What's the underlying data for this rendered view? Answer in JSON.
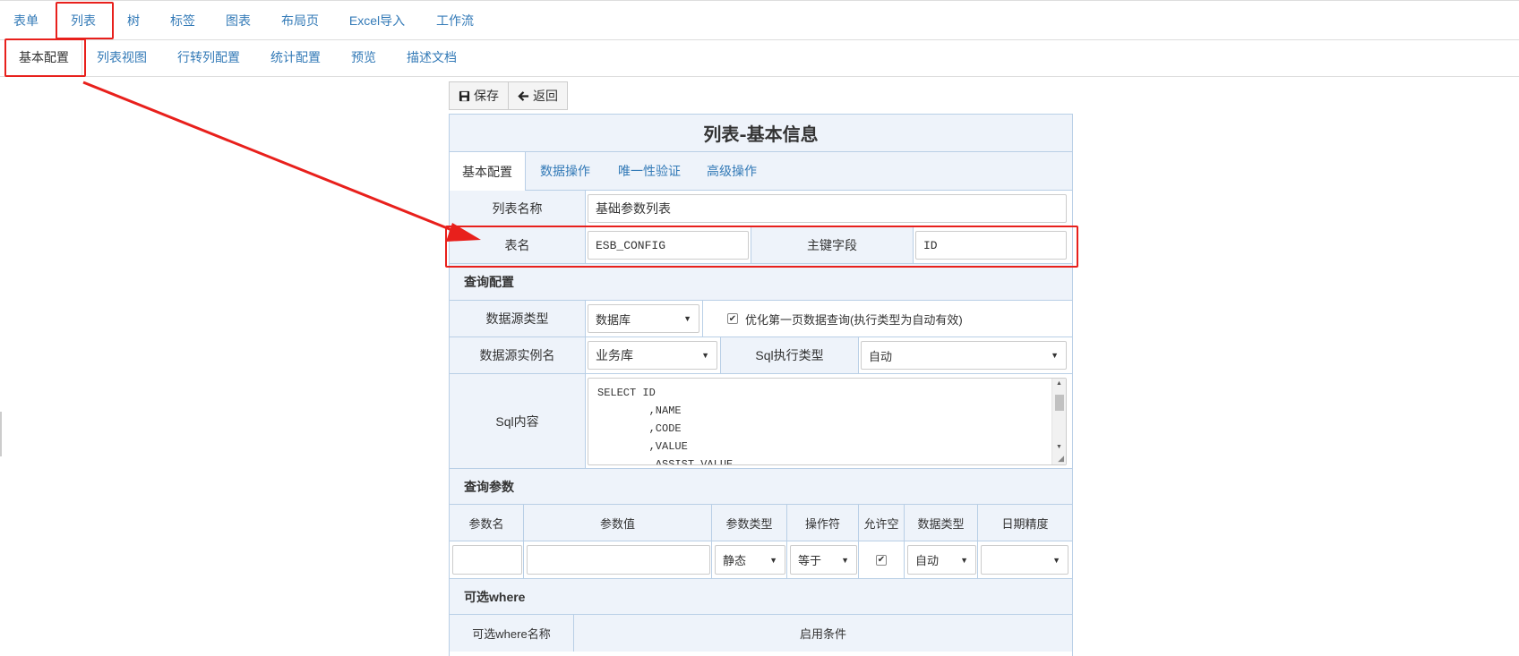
{
  "top_tabs": [
    "表单",
    "列表",
    "树",
    "标签",
    "图表",
    "布局页",
    "Excel导入",
    "工作流"
  ],
  "sub_tabs": [
    "基本配置",
    "列表视图",
    "行转列配置",
    "统计配置",
    "预览",
    "描述文档"
  ],
  "toolbar": {
    "save": "保存",
    "back": "返回"
  },
  "panel": {
    "title": "列表-基本信息",
    "tabs": [
      "基本配置",
      "数据操作",
      "唯一性验证",
      "高级操作"
    ]
  },
  "form": {
    "list_name_label": "列表名称",
    "list_name_value": "基础参数列表",
    "table_name_label": "表名",
    "table_name_value": "ESB_CONFIG",
    "pk_label": "主键字段",
    "pk_value": "ID",
    "query_config_title": "查询配置",
    "ds_type_label": "数据源类型",
    "ds_type_value": "数据库",
    "optimize_label": "优化第一页数据查询(执行类型为自动有效)",
    "ds_instance_label": "数据源实例名",
    "ds_instance_value": "业务库",
    "sql_exec_label": "Sql执行类型",
    "sql_exec_value": "自动",
    "sql_content_label": "Sql内容",
    "sql_content": "SELECT ID\n        ,NAME\n        ,CODE\n        ,VALUE\n        ,ASSIST_VALUE",
    "query_params_title": "查询参数",
    "param_headers": [
      "参数名",
      "参数值",
      "参数类型",
      "操作符",
      "允许空",
      "数据类型",
      "日期精度"
    ],
    "param_row": {
      "param_type": "静态",
      "operator": "等于",
      "data_type": "自动"
    },
    "optional_where_title": "可选where",
    "where_name_label": "可选where名称",
    "enable_condition_label": "启用条件"
  },
  "colors": {
    "accent_red": "#e8201c",
    "link": "#337ab7",
    "panel_bg": "#eef3fa",
    "panel_border": "#b9cfe6"
  },
  "icons": [
    "save-icon",
    "arrow-left-icon",
    "checkbox-checked-icon",
    "dropdown-caret-icon"
  ]
}
